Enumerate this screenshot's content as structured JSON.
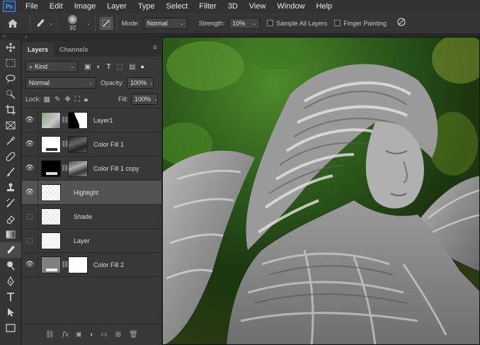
{
  "menu": [
    "File",
    "Edit",
    "Image",
    "Layer",
    "Type",
    "Select",
    "Filter",
    "3D",
    "View",
    "Window",
    "Help"
  ],
  "app_logo": "Ps",
  "options": {
    "brush_size": "92",
    "mode_label": "Mode:",
    "mode_value": "Normal",
    "strength_label": "Strength:",
    "strength_value": "10%",
    "sample_all_layers": "Sample All Layers",
    "finger_painting": "Finger Painting"
  },
  "panel": {
    "tabs": [
      "Layers",
      "Channels"
    ],
    "filter_kind": "Kind",
    "blend_mode": "Normal",
    "opacity_label": "Opacity:",
    "opacity_value": "100%",
    "lock_label": "Lock:",
    "fill_label": "Fill:",
    "fill_value": "100%"
  },
  "layers": [
    {
      "name": "Layer1",
      "visible": true,
      "selected": false
    },
    {
      "name": "Color Fill 1",
      "visible": true,
      "selected": false
    },
    {
      "name": "Color Fill 1 copy",
      "visible": true,
      "selected": false
    },
    {
      "name": "Highlight",
      "visible": true,
      "selected": true
    },
    {
      "name": "Shade",
      "visible": false,
      "selected": false
    },
    {
      "name": "Layer",
      "visible": false,
      "selected": false
    },
    {
      "name": "Color Fill 2",
      "visible": true,
      "selected": false
    }
  ],
  "colors": {
    "accent": "#4f8fd8",
    "panel": "#383838",
    "selected_row": "#535353"
  }
}
